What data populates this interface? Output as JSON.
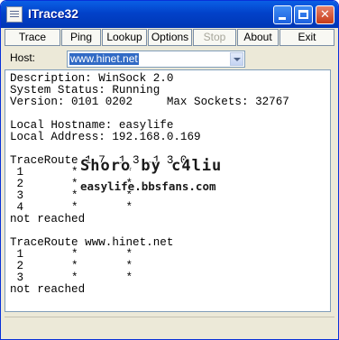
{
  "window": {
    "title": "ITrace32"
  },
  "title_buttons": {
    "minimize_icon": "minimize-icon",
    "maximize_icon": "maximize-icon",
    "close_glyph": "✕"
  },
  "toolbar": {
    "buttons": [
      {
        "label": "Trace",
        "enabled": true
      },
      {
        "label": "Ping",
        "enabled": true
      },
      {
        "label": "Lookup",
        "enabled": true
      },
      {
        "label": "Options",
        "enabled": true
      },
      {
        "label": "Stop",
        "enabled": false
      },
      {
        "label": "About",
        "enabled": true
      },
      {
        "label": "Exit",
        "enabled": true
      }
    ]
  },
  "host": {
    "label": "Host:",
    "value": "www.hinet.net"
  },
  "output": {
    "text": "Description: WinSock 2.0\nSystem Status: Running\nVersion: 0101 0202     Max Sockets: 32767\n\nLocal Hostname: easylife\nLocal Address: 192.168.0.169\n\nTraceRoute 1 7 .1 3 .1 3 0 \n 1       *       *\n 2       *       *\n 3       *       *\n 4       *       *\nnot reached\n\nTraceRoute www.hinet.net\n 1       *       *\n 2       *       *\n 3       *       *\nnot reached"
  },
  "watermark": {
    "line1": "Shoro by c4liu",
    "line2": "easylife.bbsfans.com"
  },
  "colors": {
    "titlebar": "#0242c9",
    "selection": "#316ac5",
    "close_button": "#c63b18"
  }
}
